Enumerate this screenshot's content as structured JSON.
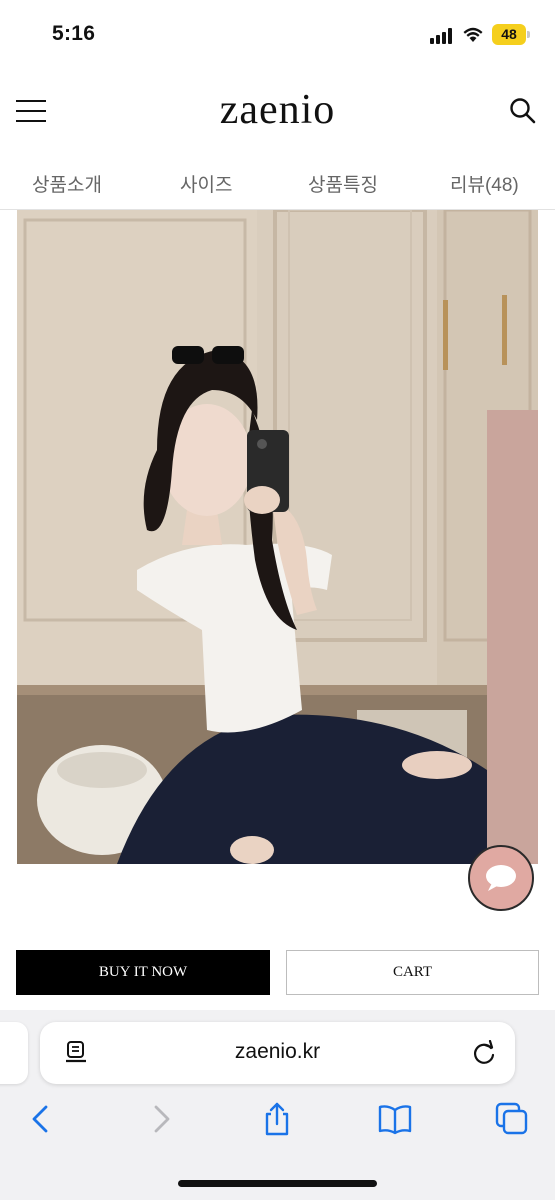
{
  "status_bar": {
    "time": "5:16",
    "battery": "48"
  },
  "header": {
    "logo": "zaenio"
  },
  "tabs": [
    {
      "label": "상품소개"
    },
    {
      "label": "사이즈"
    },
    {
      "label": "상품특징"
    },
    {
      "label": "리뷰(48)"
    }
  ],
  "actions": {
    "buy_label": "BUY IT NOW",
    "cart_label": "CART"
  },
  "browser": {
    "url": "zaenio.kr"
  },
  "colors": {
    "accent_chat": "#e0a9a2",
    "battery": "#f5cf1d",
    "safari_blue": "#1a73e8"
  },
  "icons": [
    "menu-icon",
    "search-icon",
    "chat-icon",
    "reader-icon",
    "reload-icon",
    "back-icon",
    "forward-icon",
    "share-icon",
    "bookmarks-icon",
    "tabs-icon"
  ]
}
